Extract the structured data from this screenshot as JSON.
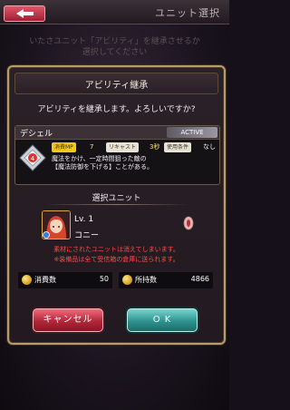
{
  "header": {
    "title": "ユニット選択"
  },
  "background_text": [
    "いたさユニット「アビリティ」を継承させるか",
    "選択してください"
  ],
  "dialog": {
    "title": "アビリティ継承",
    "message": "アビリティを継承します。よろしいですか?"
  },
  "ability": {
    "name": "デシェル",
    "badge": "ACTIVE",
    "mp_label": "消費MP",
    "mp_value": "7",
    "recast_label": "リキャスト",
    "recast_value": "3秒",
    "condition_label": "使用条件",
    "condition_value": "なし",
    "description_line1": "魔法をかけ、一定時間狙った敵の",
    "description_line2": "【魔法防御を下げる】ことがある。",
    "icon_color": "#d9342b"
  },
  "selected_unit": {
    "section_label": "選択ユニット",
    "level": "Lv. 1",
    "name": "コニー",
    "warning_line1": "素材にされたユニットは消えてしまいます。",
    "warning_line2": "※装備品は全て受信箱の倉庫に送られます。"
  },
  "costs": {
    "consume_label": "消費数",
    "consume_value": "50",
    "owned_label": "所持数",
    "owned_value": "4866"
  },
  "buttons": {
    "cancel": "キャンセル",
    "ok": "O K"
  },
  "colors": {
    "accent_gold": "#b69c6a",
    "cancel_red": "#b2263a",
    "ok_teal": "#2e938f",
    "warning_red": "#ff4848"
  }
}
